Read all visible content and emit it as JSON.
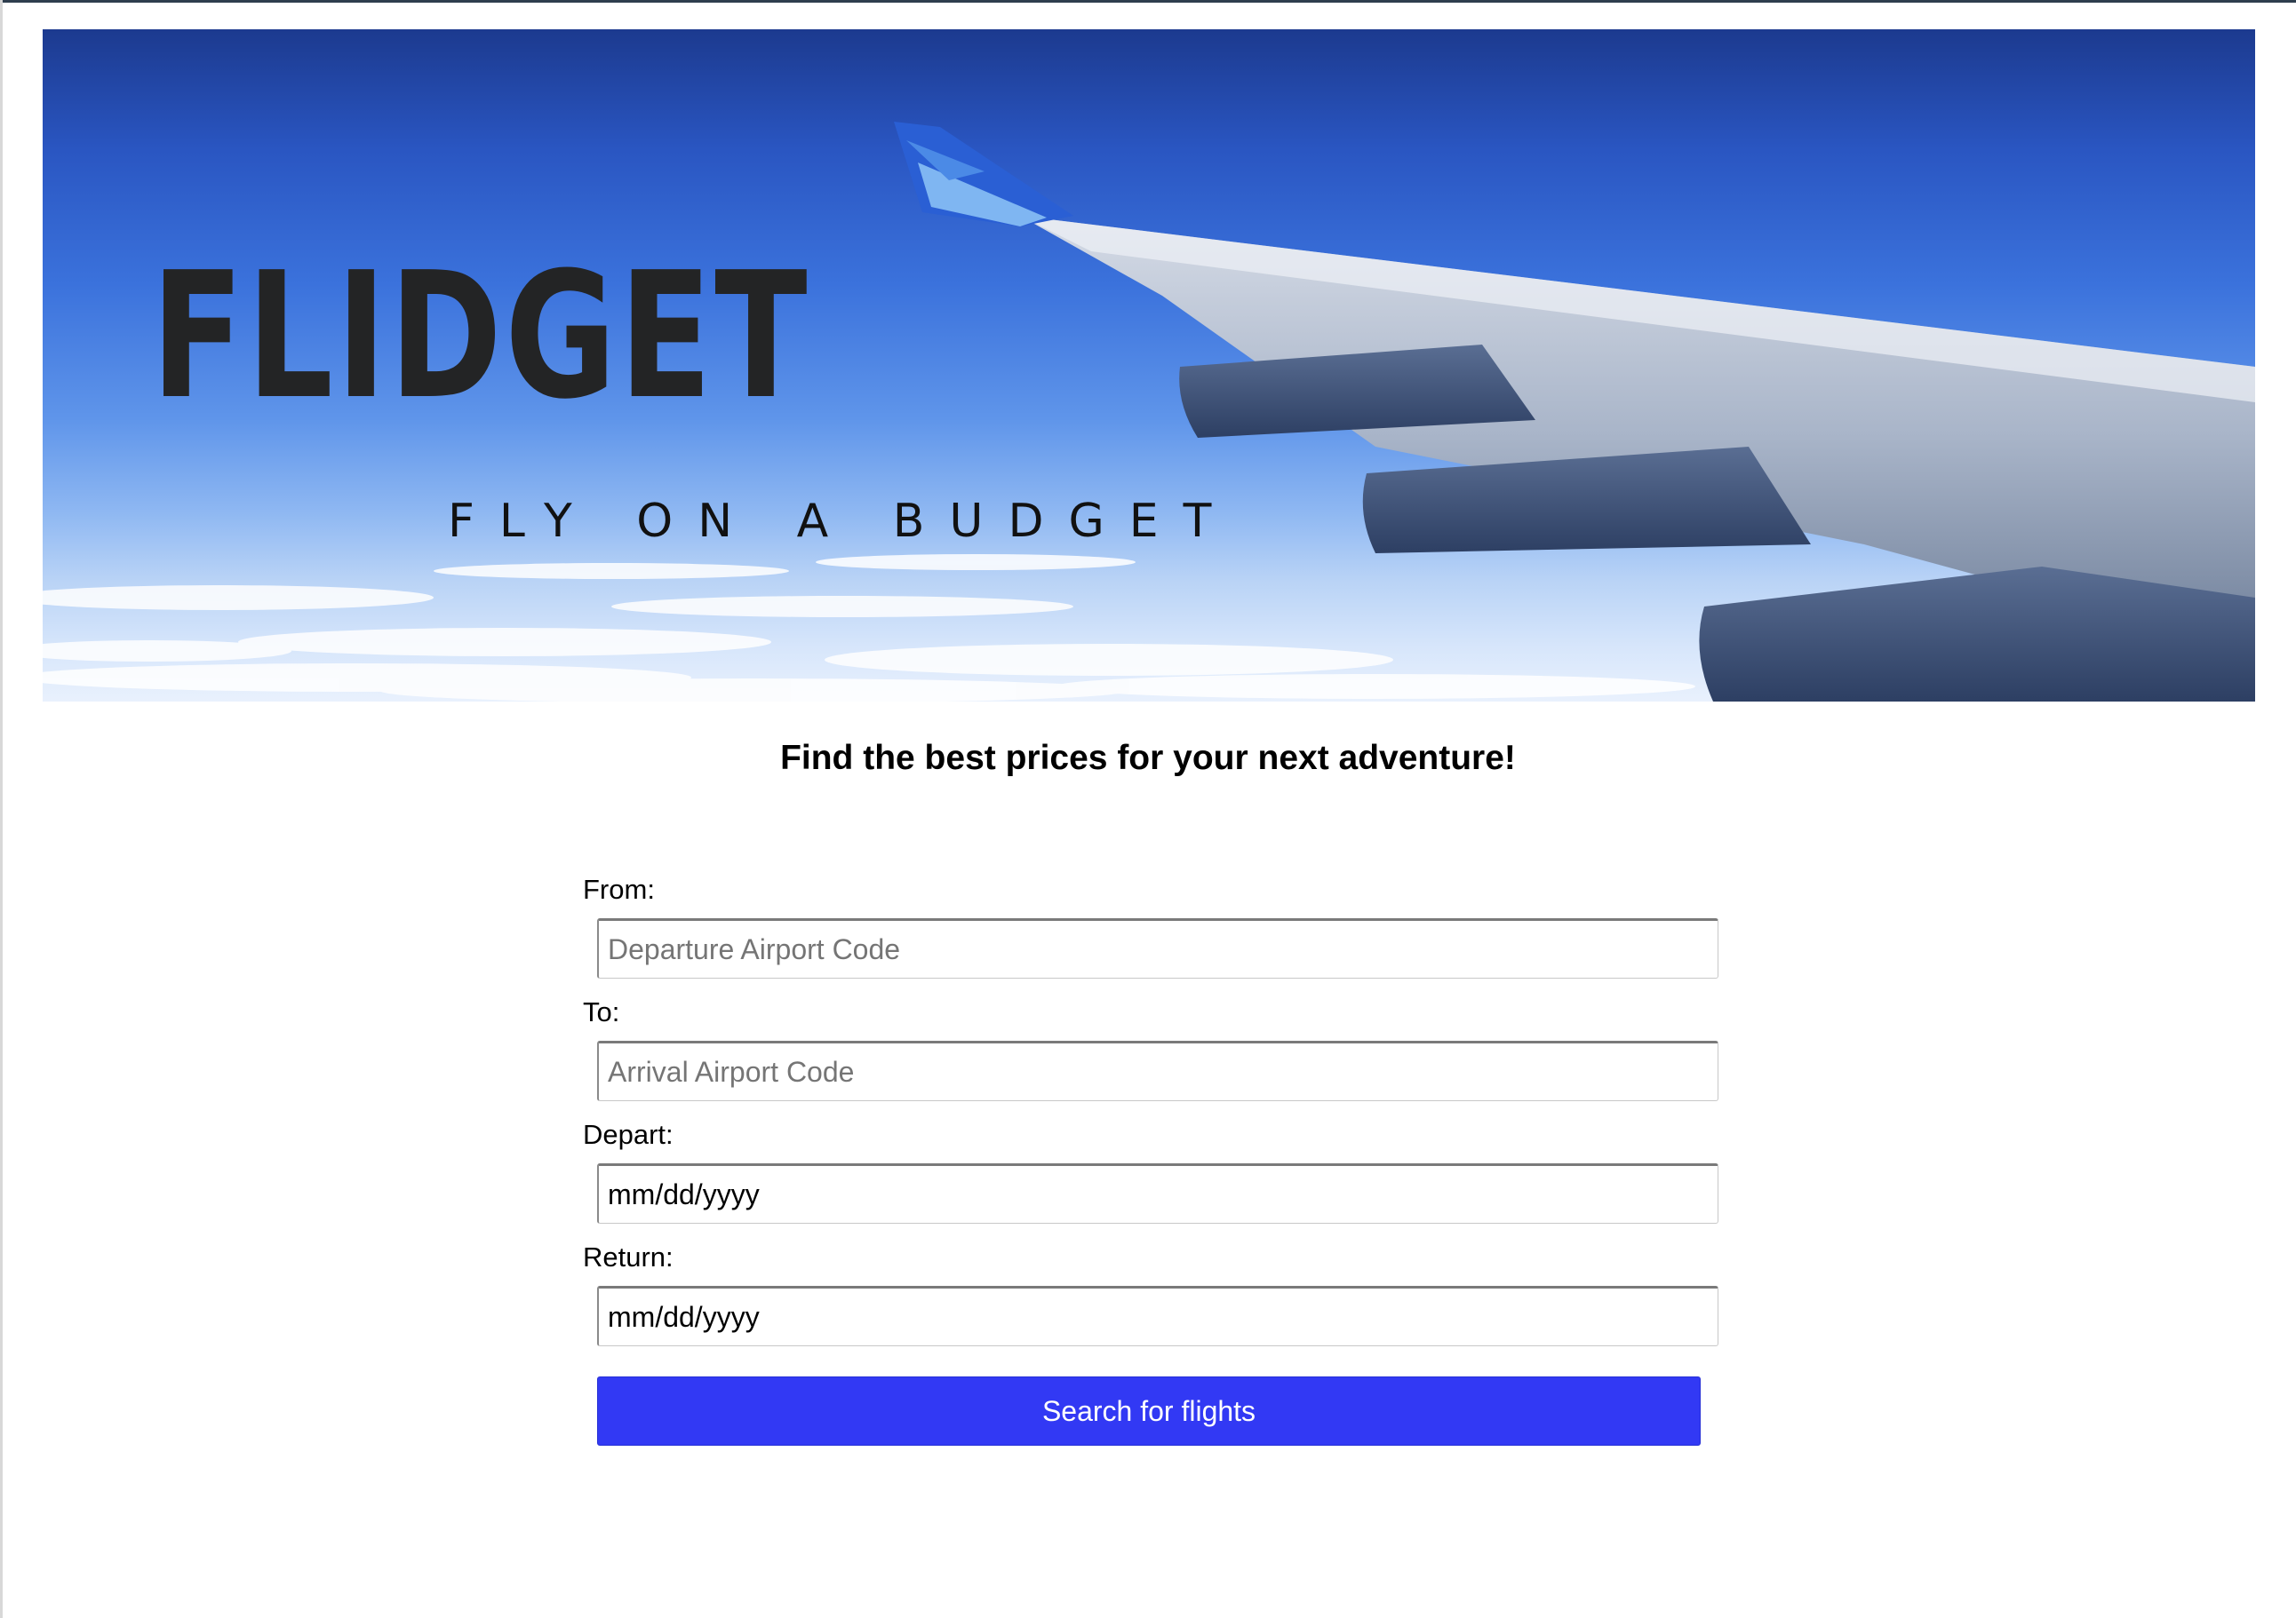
{
  "brand": {
    "name": "FLIDGET",
    "tagline": "FLY ON A BUDGET"
  },
  "headline": "Find the best prices for your next adventure!",
  "form": {
    "from": {
      "label": "From:",
      "placeholder": "Departure Airport Code",
      "value": ""
    },
    "to": {
      "label": "To:",
      "placeholder": "Arrival Airport Code",
      "value": ""
    },
    "depart": {
      "label": "Depart:",
      "value": "mm/dd/yyyy"
    },
    "return": {
      "label": "Return:",
      "value": "mm/dd/yyyy"
    },
    "submit_label": "Search for flights"
  },
  "colors": {
    "button": "#3239f4",
    "sky_top": "#1c3a8f",
    "sky_bottom": "#e9f1fd",
    "title_text": "#232425"
  }
}
